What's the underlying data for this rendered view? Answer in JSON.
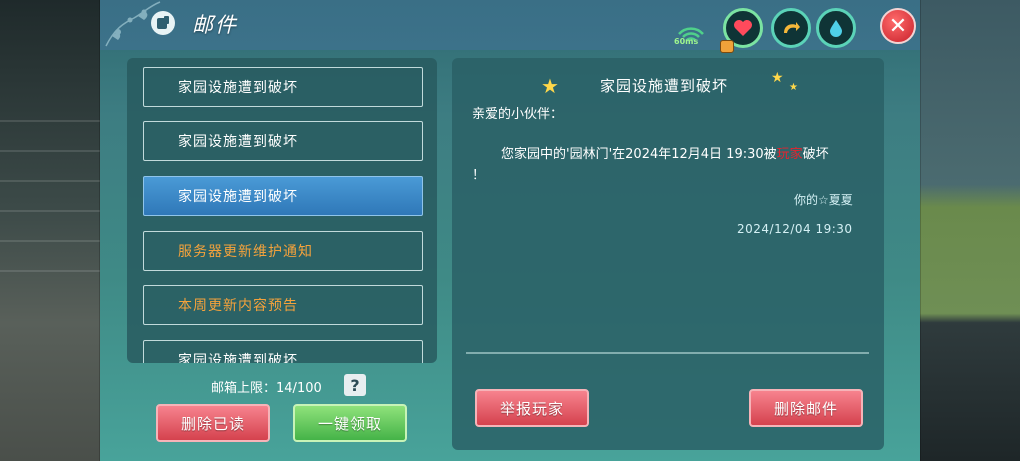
{
  "header": {
    "title": "邮件",
    "ping": "60ms"
  },
  "mail_list": {
    "items": [
      {
        "label": "家园设施遭到破坏",
        "style": "normal"
      },
      {
        "label": "家园设施遭到破坏",
        "style": "normal"
      },
      {
        "label": "家园设施遭到破坏",
        "style": "selected"
      },
      {
        "label": "服务器更新维护通知",
        "style": "orange"
      },
      {
        "label": "本周更新内容预告",
        "style": "orange"
      },
      {
        "label": "家园设施遭到破坏",
        "style": "normal"
      }
    ],
    "limit_label": "邮箱上限：",
    "limit_value": "14/100",
    "help": "?"
  },
  "buttons": {
    "delete_read": "删除已读",
    "claim_all": "一键领取",
    "report_player": "举报玩家",
    "delete_mail": "删除邮件"
  },
  "detail": {
    "title": "家园设施遭到破坏",
    "greeting": "亲爱的小伙伴：",
    "body_prefix": "您家园中的'园林门'在2024年12月4日 19:30被",
    "body_highlight": "玩家",
    "body_suffix": "破坏",
    "body_line2": "！",
    "signature": "你的☆夏夏",
    "date": "2024/12/04 19:30"
  },
  "colors": {
    "accent_selected": "#2f78b8",
    "orange_text": "#f4a23c",
    "button_red": "#d5424e",
    "button_green": "#45b348",
    "highlight_red": "#e8222e"
  }
}
